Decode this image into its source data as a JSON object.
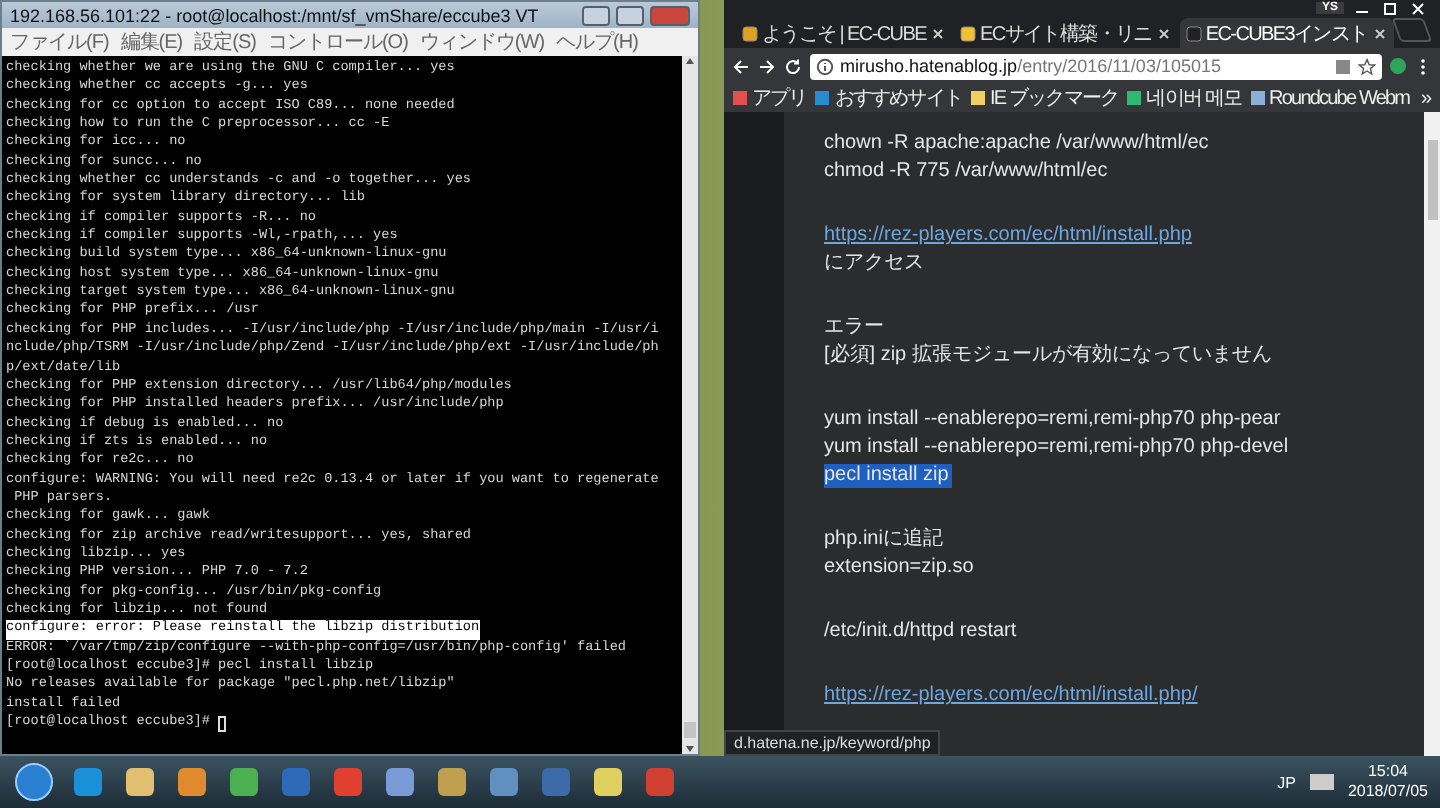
{
  "terminal": {
    "title": "192.168.56.101:22 - root@localhost:/mnt/sf_vmShare/eccube3 VT",
    "menu": [
      "ファイル(F)",
      "編集(E)",
      "設定(S)",
      "コントロール(O)",
      "ウィンドウ(W)",
      "ヘルプ(H)"
    ],
    "lines": [
      {
        "text": "checking whether we are using the GNU C compiler... yes",
        "selected": false
      },
      {
        "text": "checking whether cc accepts -g... yes",
        "selected": false
      },
      {
        "text": "checking for cc option to accept ISO C89... none needed",
        "selected": false
      },
      {
        "text": "checking how to run the C preprocessor... cc -E",
        "selected": false
      },
      {
        "text": "checking for icc... no",
        "selected": false
      },
      {
        "text": "checking for suncc... no",
        "selected": false
      },
      {
        "text": "checking whether cc understands -c and -o together... yes",
        "selected": false
      },
      {
        "text": "checking for system library directory... lib",
        "selected": false
      },
      {
        "text": "checking if compiler supports -R... no",
        "selected": false
      },
      {
        "text": "checking if compiler supports -Wl,-rpath,... yes",
        "selected": false
      },
      {
        "text": "checking build system type... x86_64-unknown-linux-gnu",
        "selected": false
      },
      {
        "text": "checking host system type... x86_64-unknown-linux-gnu",
        "selected": false
      },
      {
        "text": "checking target system type... x86_64-unknown-linux-gnu",
        "selected": false
      },
      {
        "text": "checking for PHP prefix... /usr",
        "selected": false
      },
      {
        "text": "checking for PHP includes... -I/usr/include/php -I/usr/include/php/main -I/usr/i",
        "selected": false
      },
      {
        "text": "nclude/php/TSRM -I/usr/include/php/Zend -I/usr/include/php/ext -I/usr/include/ph",
        "selected": false
      },
      {
        "text": "p/ext/date/lib",
        "selected": false
      },
      {
        "text": "checking for PHP extension directory... /usr/lib64/php/modules",
        "selected": false
      },
      {
        "text": "checking for PHP installed headers prefix... /usr/include/php",
        "selected": false
      },
      {
        "text": "checking if debug is enabled... no",
        "selected": false
      },
      {
        "text": "checking if zts is enabled... no",
        "selected": false
      },
      {
        "text": "checking for re2c... no",
        "selected": false
      },
      {
        "text": "configure: WARNING: You will need re2c 0.13.4 or later if you want to regenerate",
        "selected": false
      },
      {
        "text": " PHP parsers.",
        "selected": false
      },
      {
        "text": "checking for gawk... gawk",
        "selected": false
      },
      {
        "text": "checking for zip archive read/writesupport... yes, shared",
        "selected": false
      },
      {
        "text": "checking libzip... yes",
        "selected": false
      },
      {
        "text": "checking PHP version... PHP 7.0 - 7.2",
        "selected": false
      },
      {
        "text": "checking for pkg-config... /usr/bin/pkg-config",
        "selected": false
      },
      {
        "text": "checking for libzip... not found",
        "selected": false
      },
      {
        "text": "configure: error: Please reinstall the libzip distribution",
        "selected": true
      },
      {
        "text": "ERROR: `/var/tmp/zip/configure --with-php-config=/usr/bin/php-config' failed",
        "selected": false
      },
      {
        "text": "[root@localhost eccube3]# pecl install libzip",
        "selected": false
      },
      {
        "text": "No releases available for package \"pecl.php.net/libzip\"",
        "selected": false
      },
      {
        "text": "install failed",
        "selected": false
      },
      {
        "text": "[root@localhost eccube3]# ",
        "selected": false
      }
    ]
  },
  "browser": {
    "profile": "YS",
    "tabs": [
      {
        "label": "ようこそ | EC-CUBE",
        "selected": false
      },
      {
        "label": "ECサイト構築・リニ",
        "selected": false
      },
      {
        "label": "EC-CUBE3インスト",
        "selected": true
      }
    ],
    "address": {
      "host": "mirusho.hatenablog.jp",
      "path": "/entry/2016/11/03/105015"
    },
    "bookmarks": [
      "アプリ",
      "おすすめサイト",
      "IE ブックマーク",
      "네이버 메모",
      "Roundcube Webm"
    ],
    "bookmarks_more": "»",
    "paragraphs": [
      [
        {
          "text": "chown -R apache:apache /var/www/html/ec",
          "kind": "text",
          "selected": false
        },
        {
          "text": "chmod -R 775 /var/www/html/ec",
          "kind": "text",
          "selected": false
        }
      ],
      [
        {
          "text": "https://rez-players.com/ec/html/install.php",
          "kind": "link",
          "selected": false
        },
        {
          "text": "にアクセス",
          "kind": "text",
          "selected": false
        }
      ],
      [
        {
          "text": "エラー",
          "kind": "text",
          "selected": false
        },
        {
          "text": "[必須] zip 拡張モジュールが有効になっていません",
          "kind": "text",
          "selected": false
        }
      ],
      [
        {
          "text": "yum install --enablerepo=remi,remi-php70 php-pear",
          "kind": "text",
          "selected": false
        },
        {
          "text": "yum install --enablerepo=remi,remi-php70 php-devel",
          "kind": "text",
          "selected": false
        },
        {
          "text": "pecl install zip",
          "kind": "text",
          "selected": true
        }
      ],
      [
        {
          "text": "php.iniに追記",
          "kind": "text",
          "selected": false
        },
        {
          "text": "extension=zip.so",
          "kind": "text",
          "selected": false
        }
      ],
      [
        {
          "text": "/etc/init.d/httpd restart",
          "kind": "text",
          "selected": false
        }
      ],
      [
        {
          "text": "https://rez-players.com/ec/html/install.php/",
          "kind": "link",
          "selected": false
        }
      ]
    ],
    "status": "d.hatena.ne.jp/keyword/php"
  },
  "taskbar": {
    "language": "JP",
    "time": "15:04",
    "date": "2018/07/05"
  }
}
